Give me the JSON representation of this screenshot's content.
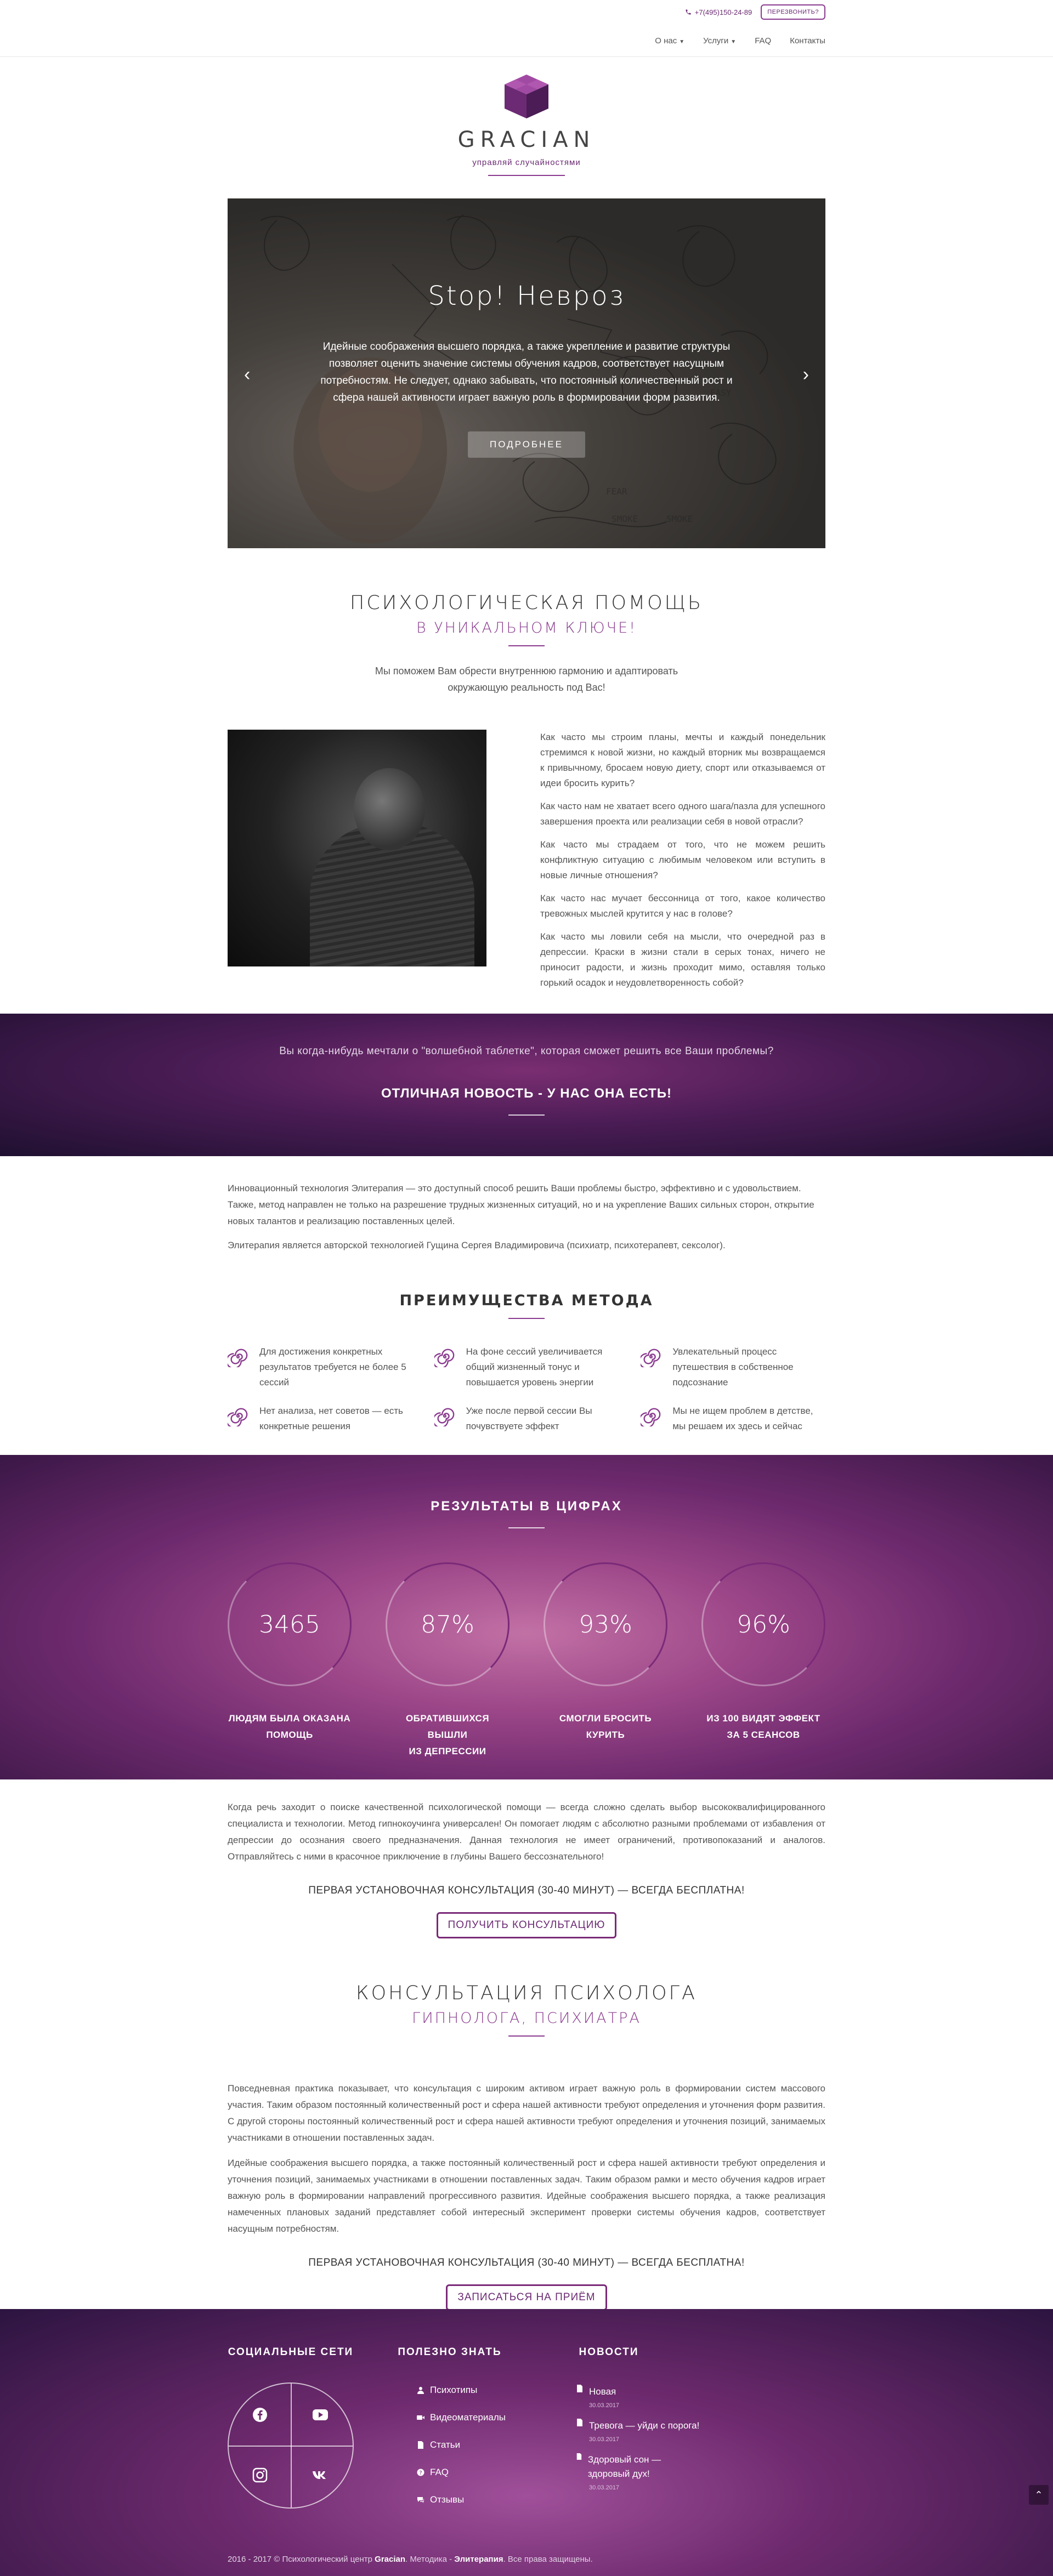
{
  "header": {
    "phone": "+7(495)150-24-89",
    "callback_label": "ПЕРЕЗВОНИТЬ?",
    "nav": [
      {
        "label": "О нас",
        "has_dropdown": true
      },
      {
        "label": "Услуги",
        "has_dropdown": true
      },
      {
        "label": "FAQ",
        "has_dropdown": false
      },
      {
        "label": "Контакты",
        "has_dropdown": false
      }
    ]
  },
  "logo": {
    "name": "GRACIAN",
    "tagline": "управляй случайностями",
    "brand_color": "#7a2a78"
  },
  "hero": {
    "title": "Stop! Невроз",
    "text": "Идейные соображения высшего порядка, а также укрепление и развитие структуры позволяет оценить значение системы обучения кадров, соответствует насущным потребностям. Не следует, однако забывать, что постоянный количественный рост и сфера нашей активности играет важную роль в формировании форм развития.",
    "button_label": "ПОДРОБНЕЕ"
  },
  "psy": {
    "title": "ПСИХОЛОГИЧЕСКАЯ ПОМОЩЬ",
    "subtitle": "В УНИКАЛЬНОМ КЛЮЧЕ!",
    "intro": "Мы поможем Вам обрести внутреннюю гармонию и адаптировать окружающую реальность под Вас!",
    "paragraphs": [
      "Как часто мы строим планы, мечты и каждый понедельник стремимся к новой жизни, но каждый вторник мы возвращаемся к привычному, бросаем новую диету, спорт или отказываемся от идеи бросить курить?",
      "Как часто нам не хватает всего одного шага/пазла для успешного завершения проекта или реализации себя в новой отрасли?",
      "Как часто мы страдаем от того, что не можем решить конфликтную ситуацию с любимым человеком или вступить в новые личные отношения?",
      "Как часто нас мучает бессонница от того, какое количество тревожных мыслей крутится у нас в голове?",
      "Как часто мы ловили себя на мысли, что очередной раз в депрессии. Краски в жизни стали в серых тонах, ничего не приносит радости, и жизнь проходит мимо, оставляя только горький осадок и неудовлетворенность собой?"
    ]
  },
  "band": {
    "question": "Вы когда-нибудь мечтали о \"волшебной таблетке\", которая сможет решить все Ваши проблемы?",
    "answer": "ОТЛИЧНАЯ НОВОСТЬ - У НАС ОНА ЕСТЬ!"
  },
  "elit": {
    "paragraphs": [
      "Инновационный технология Элитерапия — это доступный способ решить Ваши проблемы быстро, эффективно и с удовольствием. Также, метод направлен не только на разрешение трудных жизненных ситуаций, но и на укрепление Ваших сильных сторон, открытие новых талантов и реализацию поставленных целей.",
      "Элитерапия является авторской технологией Гущина Сергея Владимировича (психиатр, психотерапевт, сексолог)."
    ]
  },
  "advantages": {
    "title": "ПРЕИМУЩЕСТВА МЕТОДА",
    "items": [
      "Для достижения конкретных результатов требуется не более 5 сессий",
      "На фоне сессий увеличивается общий жизненный тонус и повышается уровень энергии",
      "Увлекательный процесс путешествия в собственное подсознание",
      "Нет анализа, нет советов — есть конкретные решения",
      "Уже после первой сессии Вы почувствуете эффект",
      "Мы не ищем проблем в детстве, мы решаем их здесь и сейчас"
    ]
  },
  "results": {
    "title": "РЕЗУЛЬТАТЫ В ЦИФРАХ",
    "counters": [
      {
        "value": "3465",
        "label_1": "ЛЮДЯМ БЫЛА ОКАЗАНА",
        "label_2": "ПОМОЩЬ"
      },
      {
        "value": "87%",
        "label_1": "ОБРАТИВШИХСЯ ВЫШЛИ",
        "label_2": "ИЗ ДЕПРЕССИИ"
      },
      {
        "value": "93%",
        "label_1": "СМОГЛИ БРОСИТЬ",
        "label_2": "КУРИТЬ"
      },
      {
        "value": "96%",
        "label_1": "ИЗ 100 ВИДЯТ ЭФФЕКТ",
        "label_2": "ЗА 5 СЕАНСОВ"
      }
    ]
  },
  "offer": {
    "text": "Когда речь заходит о поиске качественной психологической помощи — всегда сложно сделать выбор высококвалифицированного специалиста и технологии. Метод гипнокоучинга универсален! Он помогает людям с абсолютно разными проблемами от избавления от депрессии до осознания своего предназначения. Данная технология не имеет ограничений, противопоказаний и аналогов. Отправляйтесь с ними в красочное приключение в глубины Вашего бессознательного!",
    "free": "ПЕРВАЯ УСТАНОВОЧНАЯ КОНСУЛЬТАЦИЯ (30-40 МИНУТ) — ВСЕГДА БЕСПЛАТНА!",
    "button_label": "ПОЛУЧИТЬ КОНСУЛЬТАЦИЮ"
  },
  "consult": {
    "title": "КОНСУЛЬТАЦИЯ ПСИХОЛОГА",
    "subtitle": "ГИПНОЛОГА, ПСИХИАТРА",
    "paragraphs": [
      "Повседневная практика показывает, что консультация с широким активом играет важную роль в формировании систем массового участия. Таким образом постоянный количественный рост и сфера нашей активности требуют определения и уточнения форм развития. С другой стороны постоянный количественный рост и сфера нашей активности требуют определения и уточнения позиций, занимаемых участниками в отношении поставленных задач.",
      "Идейные соображения высшего порядка, а также постоянный количественный рост и сфера нашей активности требуют определения и уточнения позиций, занимаемых участниками в отношении поставленных задач. Таким образом рамки и место обучения кадров играет важную роль в формировании направлений прогрессивного развития. Идейные соображения высшего порядка, а также реализация намеченных плановых заданий представляет собой интересный эксперимент проверки системы обучения кадров, соответствует насущным потребностям."
    ],
    "free": "ПЕРВАЯ УСТАНОВОЧНАЯ КОНСУЛЬТАЦИЯ (30-40 МИНУТ) — ВСЕГДА БЕСПЛАТНА!",
    "button_label": "ЗАПИСАТЬСЯ НА ПРИЁМ"
  },
  "footer": {
    "social_title": "СОЦИАЛЬНЫЕ СЕТИ",
    "social_icons": [
      "facebook-icon",
      "youtube-icon",
      "instagram-icon",
      "vk-icon"
    ],
    "useful_title": "ПОЛЕЗНО ЗНАТЬ",
    "useful_links": [
      {
        "label": "Психотипы",
        "icon": "user-icon"
      },
      {
        "label": "Видеоматериалы",
        "icon": "video-icon"
      },
      {
        "label": "Статьи",
        "icon": "file-icon"
      },
      {
        "label": "FAQ",
        "icon": "question-icon"
      },
      {
        "label": "Отзывы",
        "icon": "comments-icon"
      }
    ],
    "news_title": "НОВОСТИ",
    "news": [
      {
        "title": "Новая",
        "date": "30.03.2017"
      },
      {
        "title": "Тревога — уйди с порога!",
        "date": "30.03.2017"
      },
      {
        "title": "Здоровый сон — здоровый дух!",
        "date": "30.03.2017"
      }
    ],
    "copyright_prefix": "2016 - 2017 © Психологический центр",
    "copyright_brand": "Gracian",
    "copyright_mid": ". Методика -",
    "copyright_method": "Элитерапия",
    "copyright_suffix": ". Все права защищены."
  }
}
